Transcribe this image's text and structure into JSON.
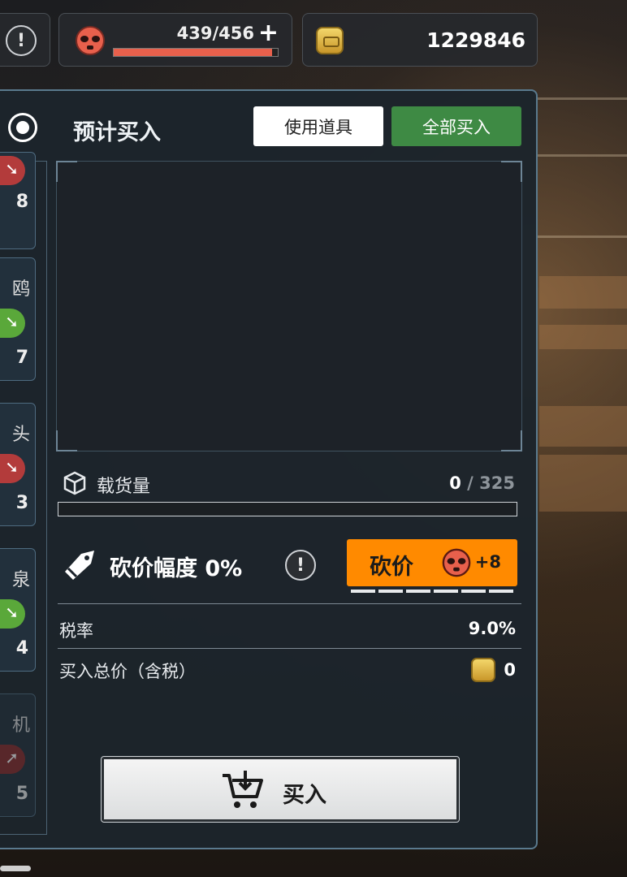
{
  "stamina": {
    "current": "439/456",
    "max_fraction": 0.963,
    "add_label": "+"
  },
  "currency": {
    "amount": "1229846"
  },
  "panel": {
    "title": "预计买入",
    "use_item_label": "使用道具",
    "buy_all_label": "全部买入"
  },
  "side_list": [
    {
      "name": "",
      "trend": "down-red",
      "value": "8"
    },
    {
      "name": "鸥",
      "trend": "down-green",
      "value": "7"
    },
    {
      "name": "头",
      "trend": "down-red",
      "value": "3"
    },
    {
      "name": "泉",
      "trend": "down-green",
      "value": "4"
    },
    {
      "name": "机",
      "trend": "up-red",
      "value": "5"
    }
  ],
  "cargo": {
    "label": "载货量",
    "current": "0",
    "separator": " / ",
    "capacity": "325"
  },
  "haggle": {
    "label": "砍价幅度 0%",
    "button_label": "砍价",
    "cost": "+8",
    "steps_total": 6
  },
  "tax": {
    "label": "税率",
    "value": "9.0%"
  },
  "total": {
    "label": "买入总价（含税）",
    "value": "0"
  },
  "buy_button": {
    "label": "买入"
  },
  "colors": {
    "accent_orange": "#ff8a00",
    "buy_all_green": "#3e8a44",
    "stamina_red": "#e8604c"
  },
  "icons": [
    "alert-icon",
    "mask-icon",
    "coin-icon",
    "radio-icon",
    "cube-icon",
    "tag-icon",
    "info-icon",
    "cart-icon"
  ]
}
